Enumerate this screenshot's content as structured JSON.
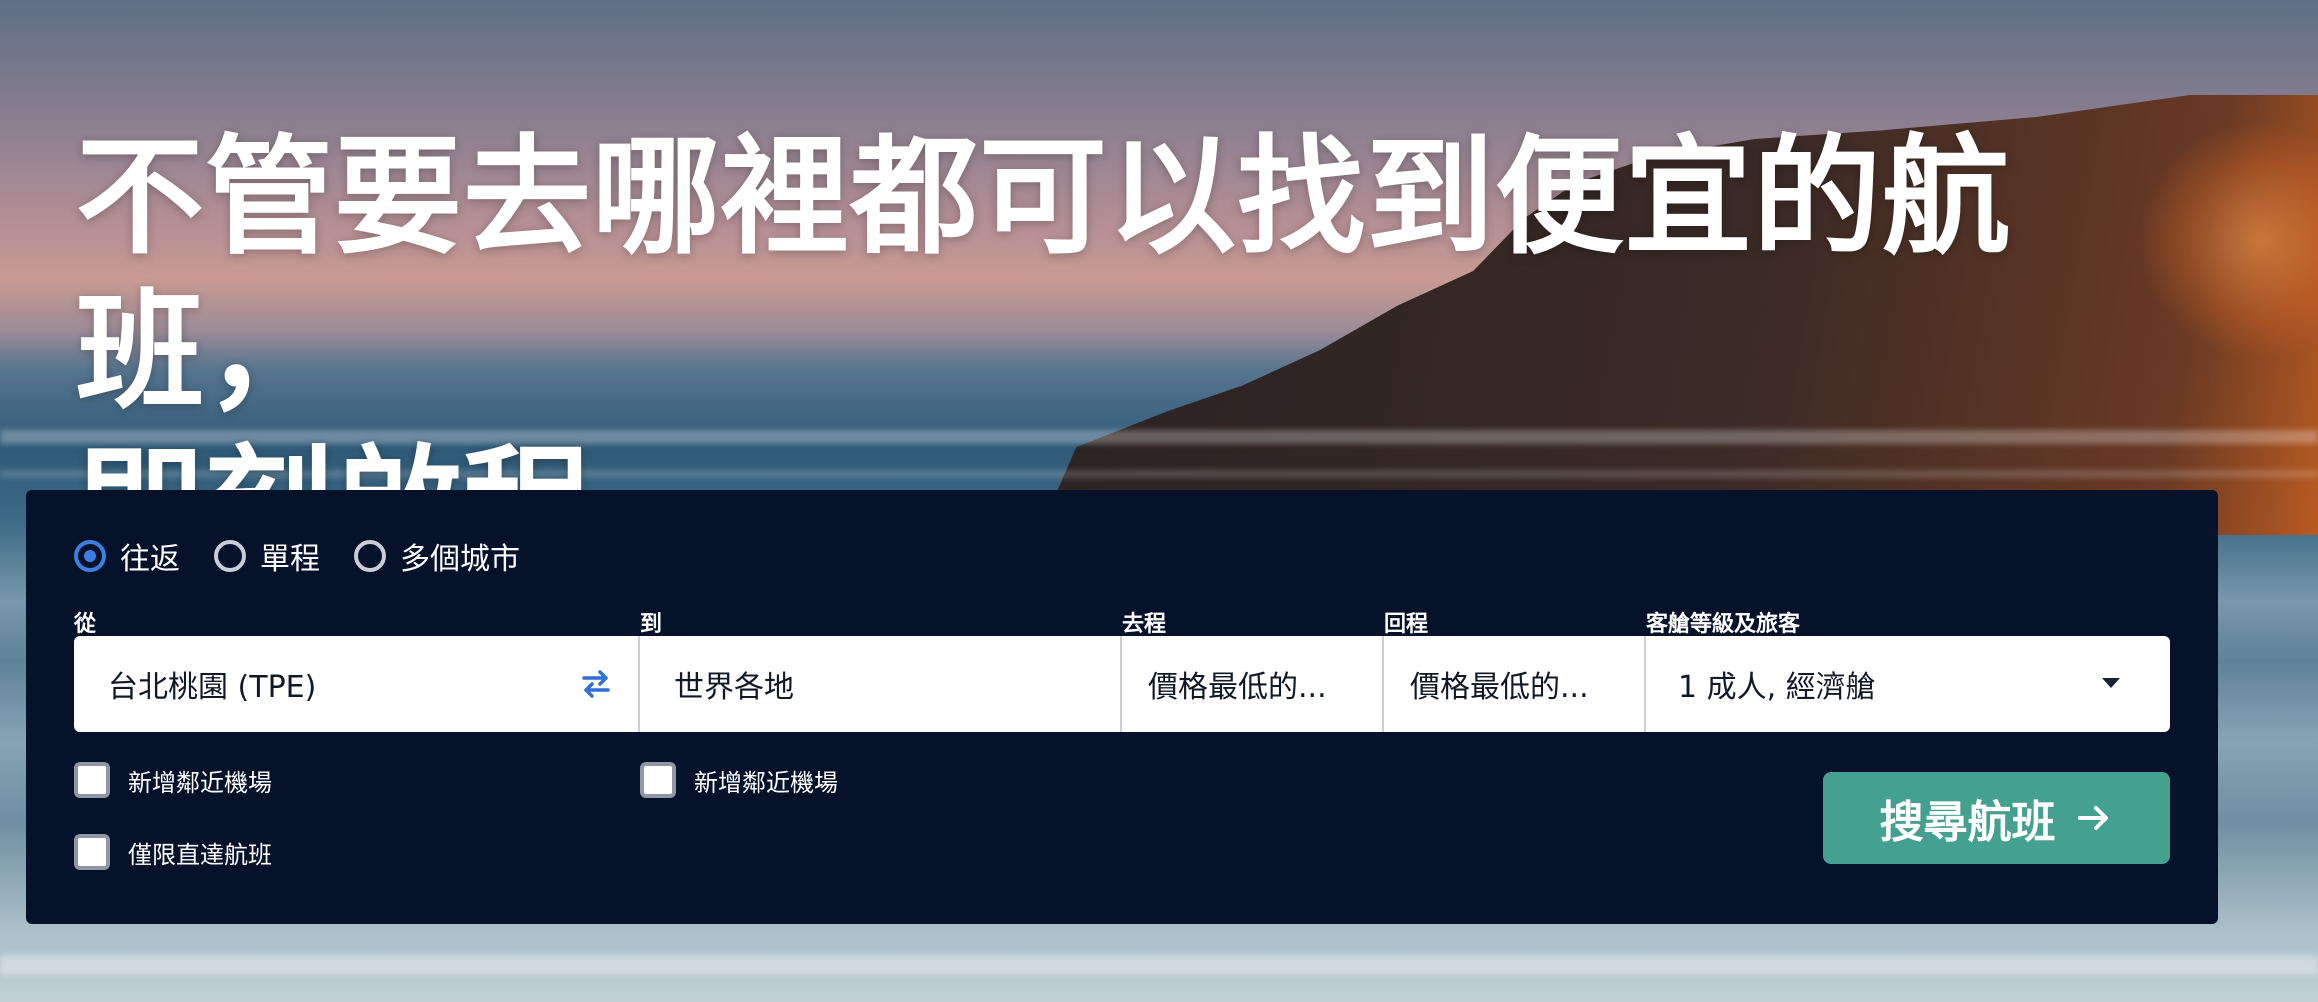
{
  "headline": {
    "line1": "不管要去哪裡都可以找到便宜的航班，",
    "line2": "即刻啟程"
  },
  "trip_types": [
    {
      "label": "往返",
      "selected": true
    },
    {
      "label": "單程",
      "selected": false
    },
    {
      "label": "多個城市",
      "selected": false
    }
  ],
  "fields": {
    "from": {
      "label": "從",
      "value": "台北桃園 (TPE)"
    },
    "to": {
      "label": "到",
      "value": "世界各地"
    },
    "depart": {
      "label": "去程",
      "value": "價格最低的..."
    },
    "return": {
      "label": "回程",
      "value": "價格最低的..."
    },
    "cabin": {
      "label": "客艙等級及旅客",
      "value": "1 成人, 經濟艙"
    }
  },
  "checkboxes": {
    "from_nearby": {
      "label": "新增鄰近機場",
      "checked": false
    },
    "to_nearby": {
      "label": "新增鄰近機場",
      "checked": false
    },
    "direct_only": {
      "label": "僅限直達航班",
      "checked": false
    }
  },
  "search_button": {
    "label": "搜尋航班"
  },
  "colors": {
    "panel": "#05122a",
    "accent_radio": "#3d7fe0",
    "search_button": "#44a08f"
  },
  "icons": {
    "swap": "swap-arrows-icon",
    "dropdown": "caret-down-icon",
    "search_arrow": "arrow-right-icon"
  }
}
